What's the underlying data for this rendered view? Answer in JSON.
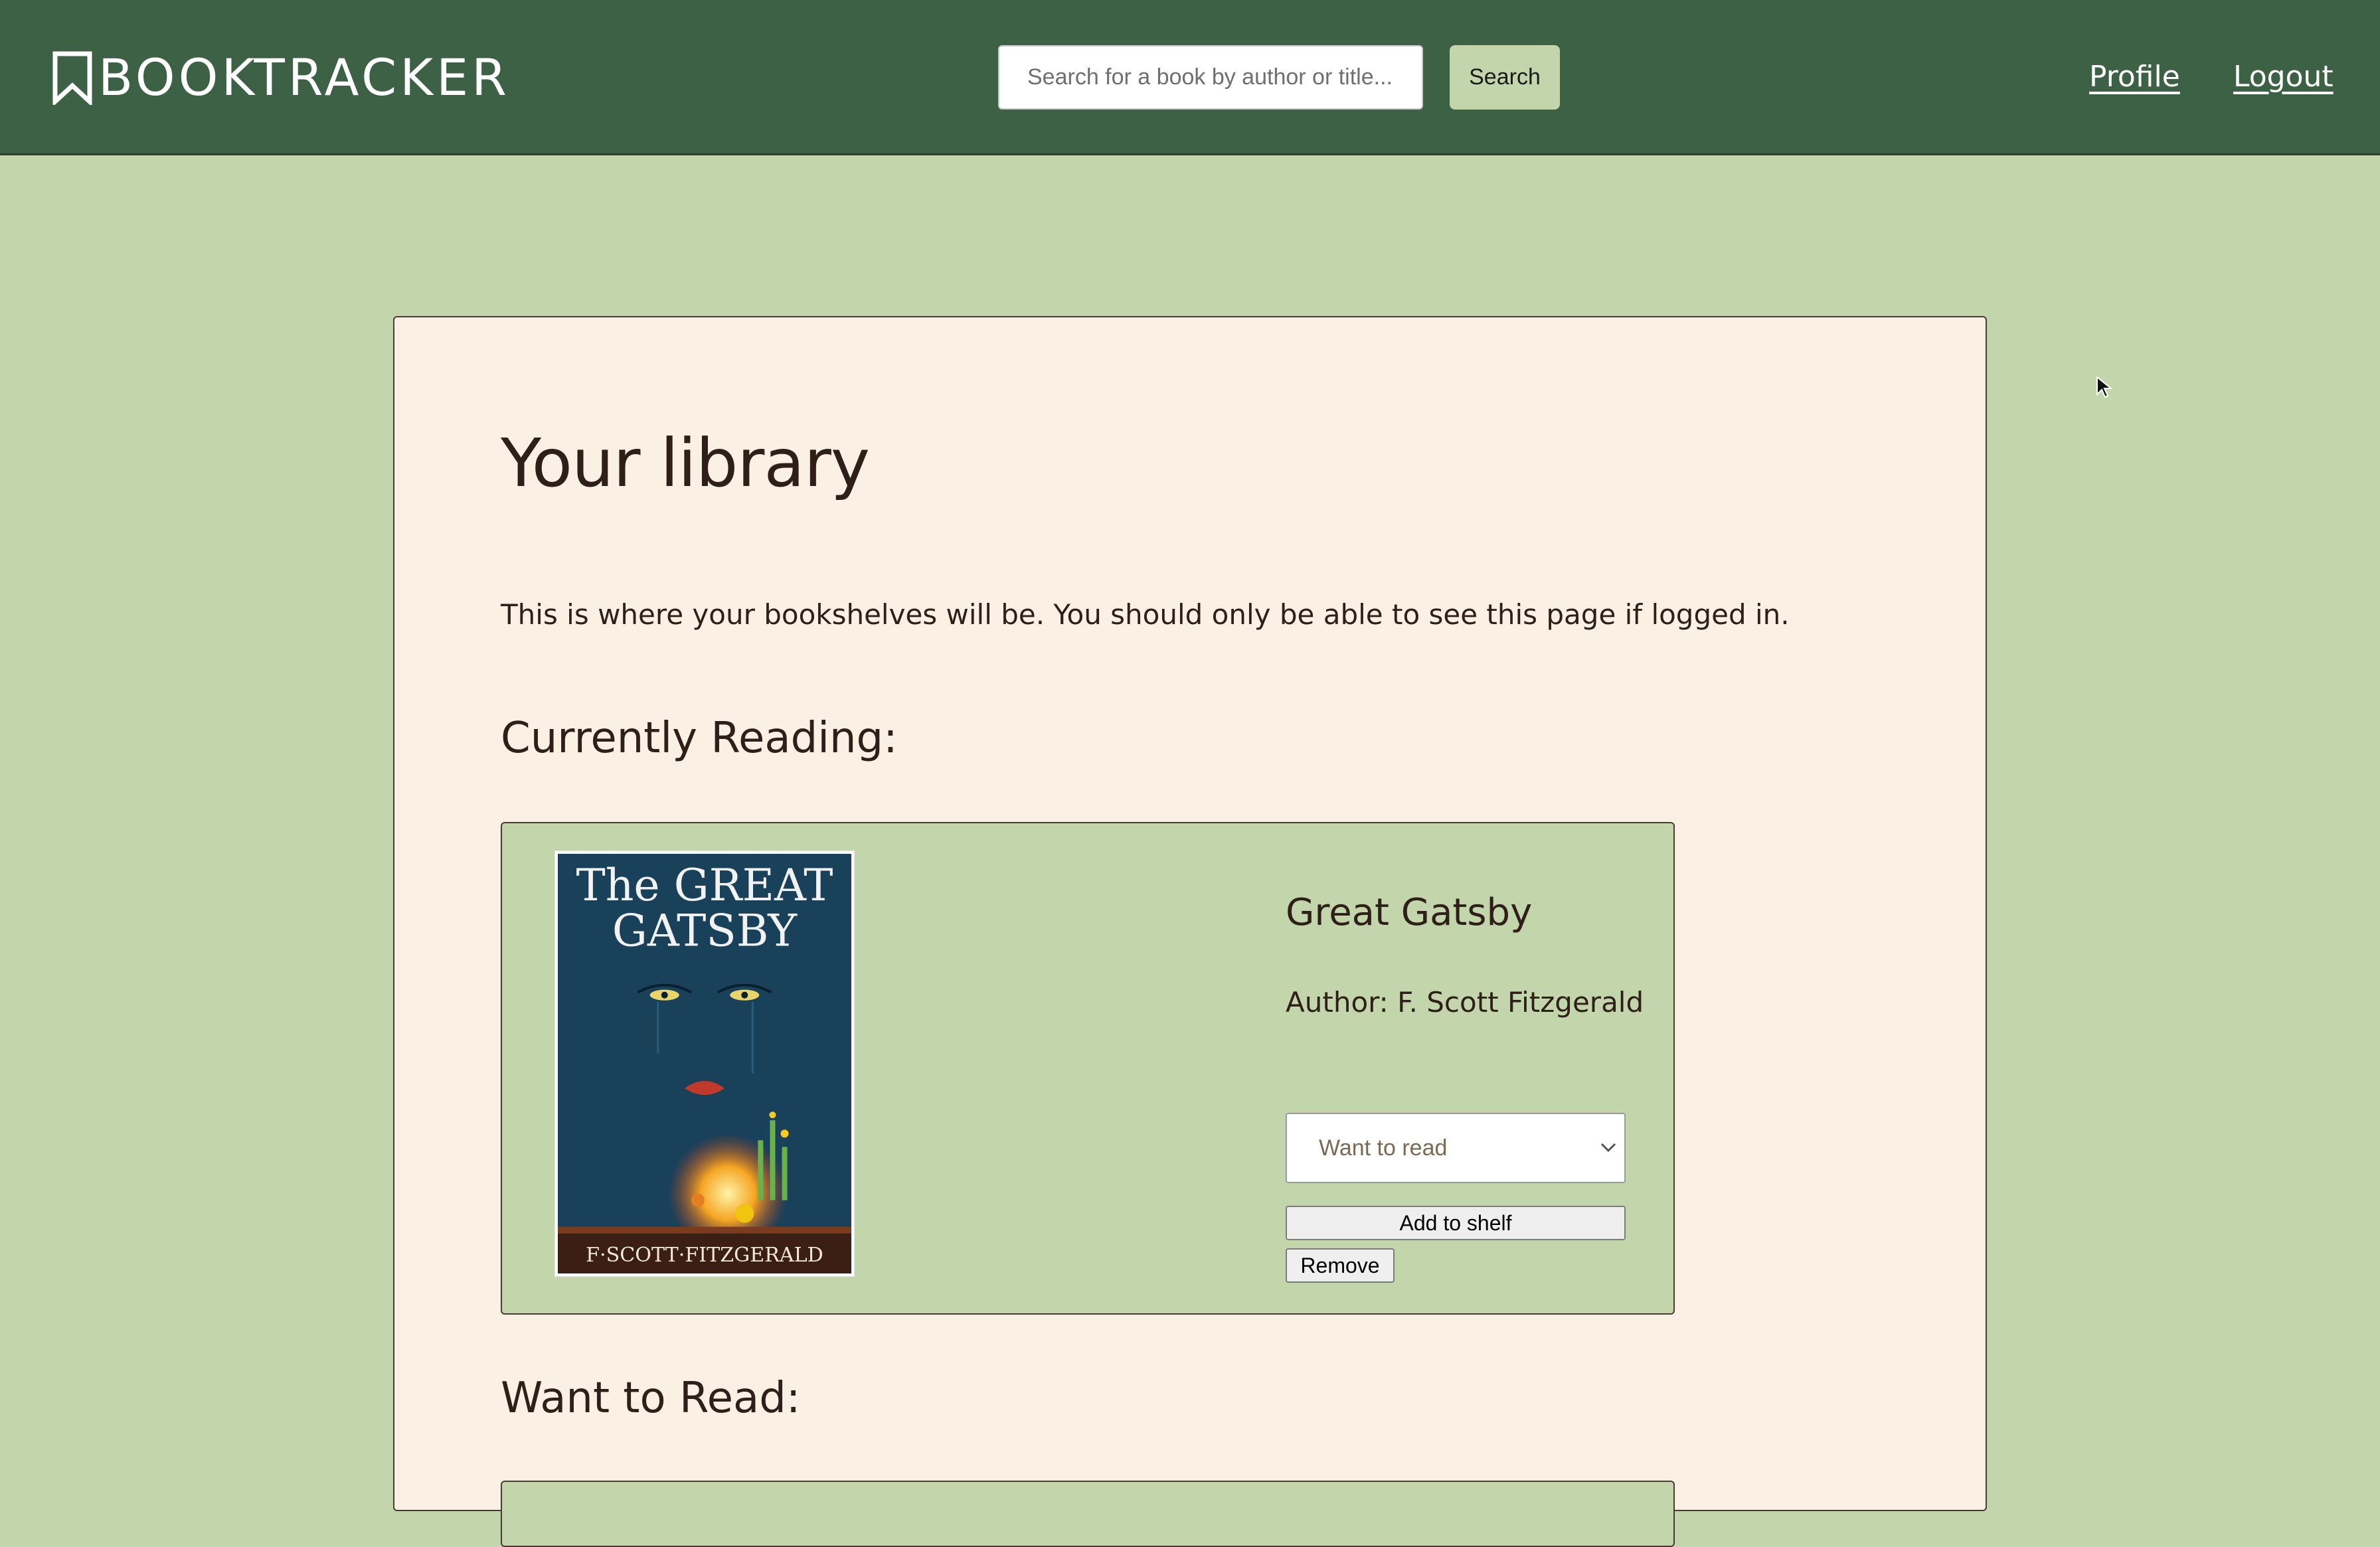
{
  "header": {
    "brand": "BOOKTRACKER",
    "search_placeholder": "Search for a book by author or title...",
    "search_label": "Search",
    "nav": {
      "profile": "Profile",
      "logout": "Logout"
    }
  },
  "library": {
    "title": "Your library",
    "intro": "This is where your bookshelves will be. You should only be able to see this page if logged in.",
    "sections": {
      "currently_reading": "Currently Reading:",
      "want_to_read": "Want to Read:"
    },
    "current_book": {
      "title": "Great Gatsby",
      "author": "Author: F. Scott Fitzgerald",
      "cover": {
        "title_line1": "The GREAT",
        "title_line2": "GATSBY",
        "author": "F·SCOTT·FITZGERALD"
      },
      "shelf_selected": "Want to read",
      "add_label": "Add to shelf",
      "remove_label": "Remove"
    }
  },
  "icons": {
    "brand": "bookmark-icon",
    "select": "chevron-down-icon",
    "cursor": "mouse-cursor-icon"
  },
  "colors": {
    "header_bg": "#3d6144",
    "page_bg": "#c3d5ab",
    "card_bg": "#faf0e4",
    "text": "#2f1f19"
  }
}
